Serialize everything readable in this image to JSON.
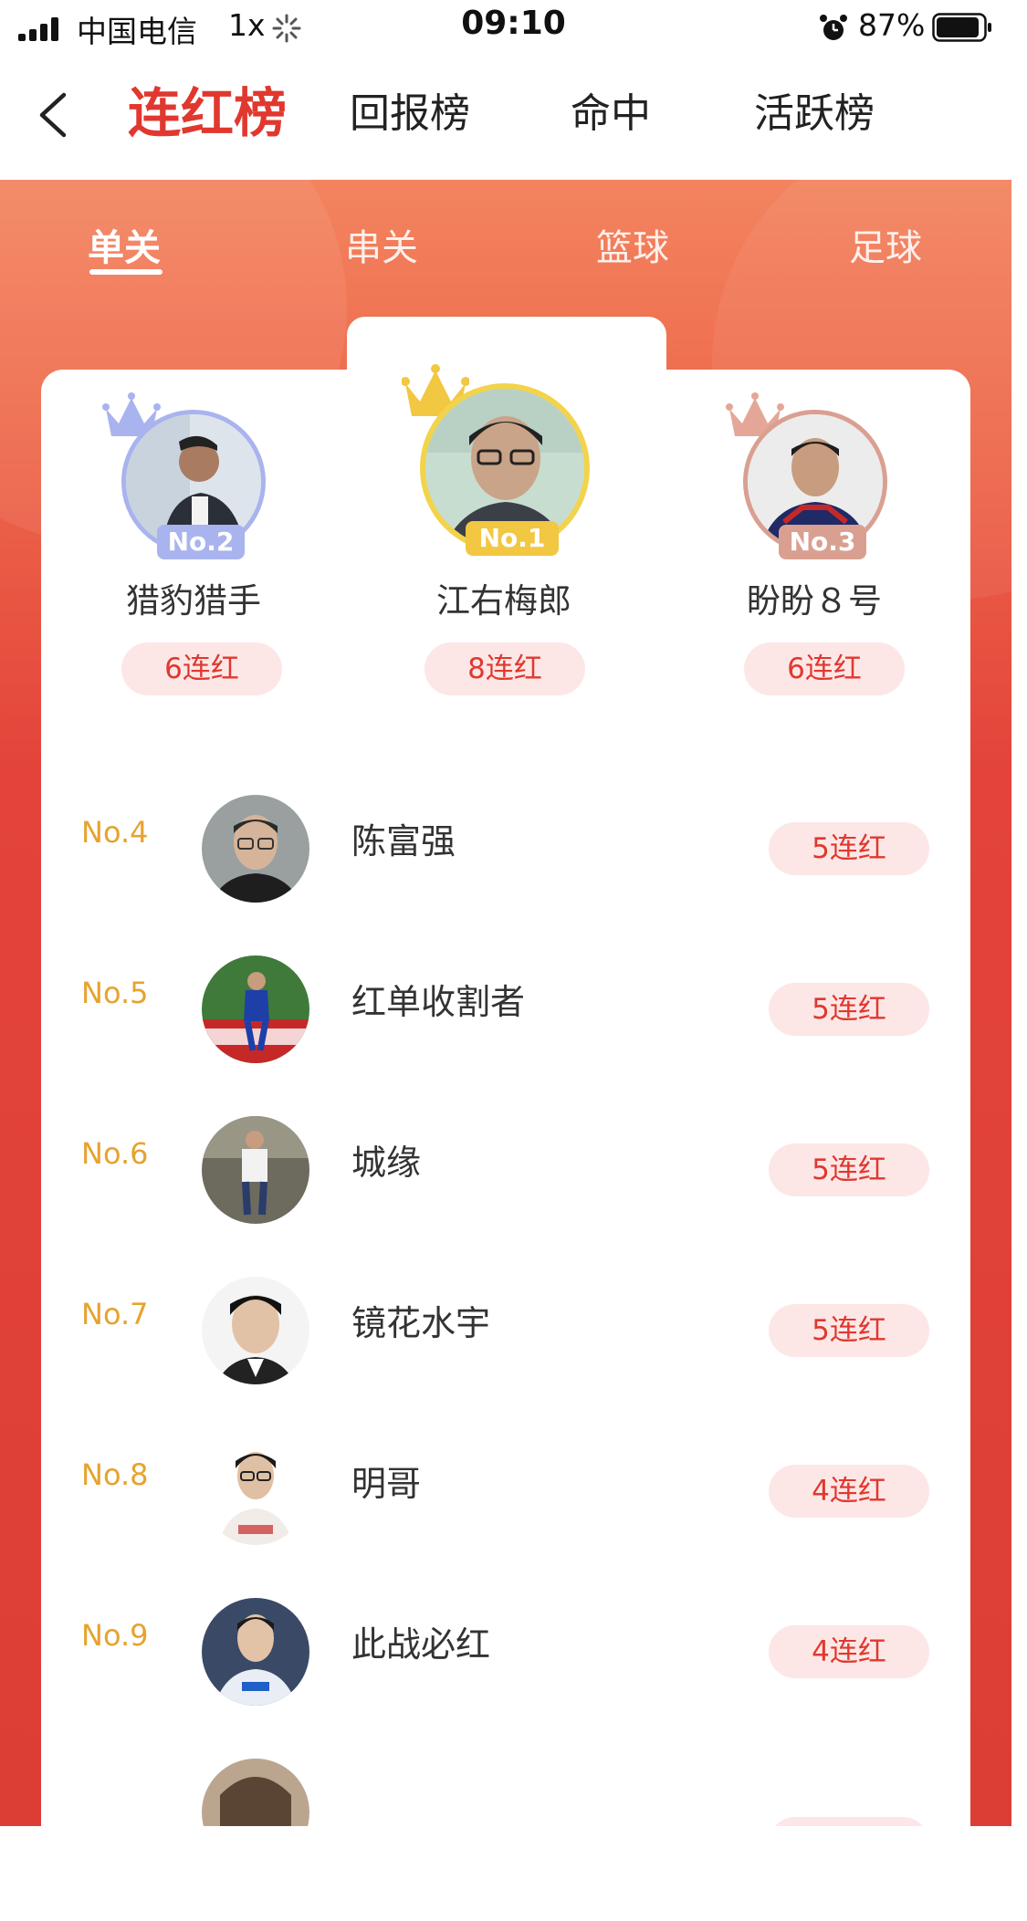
{
  "status_bar": {
    "carrier": "中国电信",
    "network": "1x",
    "time": "09:10",
    "battery": "87%"
  },
  "nav": {
    "tabs": [
      {
        "label": "连红榜",
        "active": true
      },
      {
        "label": "回报榜",
        "active": false
      },
      {
        "label": "命中",
        "active": false
      },
      {
        "label": "活跃榜",
        "active": false
      }
    ]
  },
  "sub_tabs": [
    {
      "label": "单关",
      "active": true
    },
    {
      "label": "串关",
      "active": false
    },
    {
      "label": "篮球",
      "active": false
    },
    {
      "label": "足球",
      "active": false
    }
  ],
  "podium": {
    "first": {
      "rank": "No.1",
      "name": "江右梅郎",
      "streak": "8连红"
    },
    "second": {
      "rank": "No.2",
      "name": "猎豹猎手",
      "streak": "6连红"
    },
    "third": {
      "rank": "No.3",
      "name": "盼盼８号",
      "streak": "6连红"
    }
  },
  "list": [
    {
      "rank": "No.4",
      "name": "陈富强",
      "streak": "5连红"
    },
    {
      "rank": "No.5",
      "name": "红单收割者",
      "streak": "5连红"
    },
    {
      "rank": "No.6",
      "name": "城缘",
      "streak": "5连红"
    },
    {
      "rank": "No.7",
      "name": "镜花水宇",
      "streak": "5连红"
    },
    {
      "rank": "No.8",
      "name": "明哥",
      "streak": "4连红"
    },
    {
      "rank": "No.9",
      "name": "此战必红",
      "streak": "4连红"
    }
  ],
  "colors": {
    "accent": "#e0382f",
    "rank_gold": "#e6a32e",
    "pill_bg": "#fce7e6",
    "silver": "#a9b3ee",
    "gold": "#f2c741",
    "bronze": "#d9a091"
  }
}
